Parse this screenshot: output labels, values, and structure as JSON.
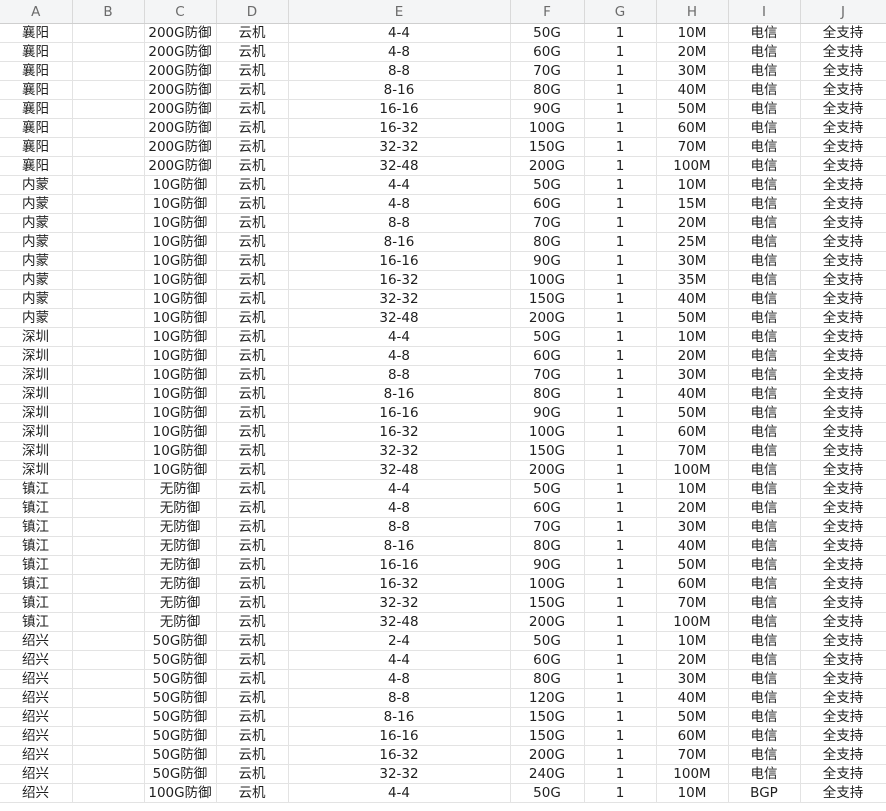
{
  "sheet": {
    "columns": [
      "A",
      "B",
      "C",
      "D",
      "E",
      "F",
      "G",
      "H",
      "I",
      "J"
    ],
    "rows": [
      [
        "襄阳",
        "",
        "200G防御",
        "云机",
        "4-4",
        "50G",
        "1",
        "10M",
        "电信",
        "全支持"
      ],
      [
        "襄阳",
        "",
        "200G防御",
        "云机",
        "4-8",
        "60G",
        "1",
        "20M",
        "电信",
        "全支持"
      ],
      [
        "襄阳",
        "",
        "200G防御",
        "云机",
        "8-8",
        "70G",
        "1",
        "30M",
        "电信",
        "全支持"
      ],
      [
        "襄阳",
        "",
        "200G防御",
        "云机",
        "8-16",
        "80G",
        "1",
        "40M",
        "电信",
        "全支持"
      ],
      [
        "襄阳",
        "",
        "200G防御",
        "云机",
        "16-16",
        "90G",
        "1",
        "50M",
        "电信",
        "全支持"
      ],
      [
        "襄阳",
        "",
        "200G防御",
        "云机",
        "16-32",
        "100G",
        "1",
        "60M",
        "电信",
        "全支持"
      ],
      [
        "襄阳",
        "",
        "200G防御",
        "云机",
        "32-32",
        "150G",
        "1",
        "70M",
        "电信",
        "全支持"
      ],
      [
        "襄阳",
        "",
        "200G防御",
        "云机",
        "32-48",
        "200G",
        "1",
        "100M",
        "电信",
        "全支持"
      ],
      [
        "内蒙",
        "",
        "10G防御",
        "云机",
        "4-4",
        "50G",
        "1",
        "10M",
        "电信",
        "全支持"
      ],
      [
        "内蒙",
        "",
        "10G防御",
        "云机",
        "4-8",
        "60G",
        "1",
        "15M",
        "电信",
        "全支持"
      ],
      [
        "内蒙",
        "",
        "10G防御",
        "云机",
        "8-8",
        "70G",
        "1",
        "20M",
        "电信",
        "全支持"
      ],
      [
        "内蒙",
        "",
        "10G防御",
        "云机",
        "8-16",
        "80G",
        "1",
        "25M",
        "电信",
        "全支持"
      ],
      [
        "内蒙",
        "",
        "10G防御",
        "云机",
        "16-16",
        "90G",
        "1",
        "30M",
        "电信",
        "全支持"
      ],
      [
        "内蒙",
        "",
        "10G防御",
        "云机",
        "16-32",
        "100G",
        "1",
        "35M",
        "电信",
        "全支持"
      ],
      [
        "内蒙",
        "",
        "10G防御",
        "云机",
        "32-32",
        "150G",
        "1",
        "40M",
        "电信",
        "全支持"
      ],
      [
        "内蒙",
        "",
        "10G防御",
        "云机",
        "32-48",
        "200G",
        "1",
        "50M",
        "电信",
        "全支持"
      ],
      [
        "深圳",
        "",
        "10G防御",
        "云机",
        "4-4",
        "50G",
        "1",
        "10M",
        "电信",
        "全支持"
      ],
      [
        "深圳",
        "",
        "10G防御",
        "云机",
        "4-8",
        "60G",
        "1",
        "20M",
        "电信",
        "全支持"
      ],
      [
        "深圳",
        "",
        "10G防御",
        "云机",
        "8-8",
        "70G",
        "1",
        "30M",
        "电信",
        "全支持"
      ],
      [
        "深圳",
        "",
        "10G防御",
        "云机",
        "8-16",
        "80G",
        "1",
        "40M",
        "电信",
        "全支持"
      ],
      [
        "深圳",
        "",
        "10G防御",
        "云机",
        "16-16",
        "90G",
        "1",
        "50M",
        "电信",
        "全支持"
      ],
      [
        "深圳",
        "",
        "10G防御",
        "云机",
        "16-32",
        "100G",
        "1",
        "60M",
        "电信",
        "全支持"
      ],
      [
        "深圳",
        "",
        "10G防御",
        "云机",
        "32-32",
        "150G",
        "1",
        "70M",
        "电信",
        "全支持"
      ],
      [
        "深圳",
        "",
        "10G防御",
        "云机",
        "32-48",
        "200G",
        "1",
        "100M",
        "电信",
        "全支持"
      ],
      [
        "镇江",
        "",
        "无防御",
        "云机",
        "4-4",
        "50G",
        "1",
        "10M",
        "电信",
        "全支持"
      ],
      [
        "镇江",
        "",
        "无防御",
        "云机",
        "4-8",
        "60G",
        "1",
        "20M",
        "电信",
        "全支持"
      ],
      [
        "镇江",
        "",
        "无防御",
        "云机",
        "8-8",
        "70G",
        "1",
        "30M",
        "电信",
        "全支持"
      ],
      [
        "镇江",
        "",
        "无防御",
        "云机",
        "8-16",
        "80G",
        "1",
        "40M",
        "电信",
        "全支持"
      ],
      [
        "镇江",
        "",
        "无防御",
        "云机",
        "16-16",
        "90G",
        "1",
        "50M",
        "电信",
        "全支持"
      ],
      [
        "镇江",
        "",
        "无防御",
        "云机",
        "16-32",
        "100G",
        "1",
        "60M",
        "电信",
        "全支持"
      ],
      [
        "镇江",
        "",
        "无防御",
        "云机",
        "32-32",
        "150G",
        "1",
        "70M",
        "电信",
        "全支持"
      ],
      [
        "镇江",
        "",
        "无防御",
        "云机",
        "32-48",
        "200G",
        "1",
        "100M",
        "电信",
        "全支持"
      ],
      [
        "绍兴",
        "",
        "50G防御",
        "云机",
        "2-4",
        "50G",
        "1",
        "10M",
        "电信",
        "全支持"
      ],
      [
        "绍兴",
        "",
        "50G防御",
        "云机",
        "4-4",
        "60G",
        "1",
        "20M",
        "电信",
        "全支持"
      ],
      [
        "绍兴",
        "",
        "50G防御",
        "云机",
        "4-8",
        "80G",
        "1",
        "30M",
        "电信",
        "全支持"
      ],
      [
        "绍兴",
        "",
        "50G防御",
        "云机",
        "8-8",
        "120G",
        "1",
        "40M",
        "电信",
        "全支持"
      ],
      [
        "绍兴",
        "",
        "50G防御",
        "云机",
        "8-16",
        "150G",
        "1",
        "50M",
        "电信",
        "全支持"
      ],
      [
        "绍兴",
        "",
        "50G防御",
        "云机",
        "16-16",
        "150G",
        "1",
        "60M",
        "电信",
        "全支持"
      ],
      [
        "绍兴",
        "",
        "50G防御",
        "云机",
        "16-32",
        "200G",
        "1",
        "70M",
        "电信",
        "全支持"
      ],
      [
        "绍兴",
        "",
        "50G防御",
        "云机",
        "32-32",
        "240G",
        "1",
        "100M",
        "电信",
        "全支持"
      ],
      [
        "绍兴",
        "",
        "100G防御",
        "云机",
        "4-4",
        "50G",
        "1",
        "10M",
        "BGP",
        "全支持"
      ]
    ]
  }
}
